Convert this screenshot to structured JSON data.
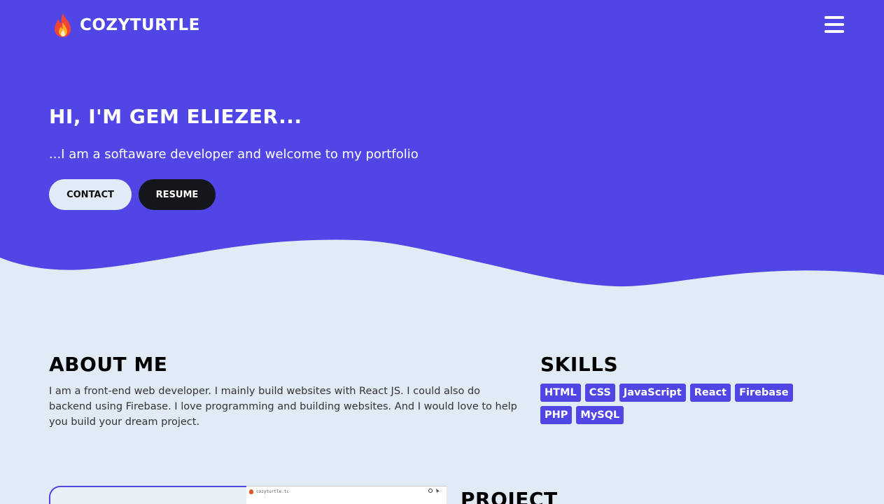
{
  "colors": {
    "primary": "#4f46e5",
    "background": "#e0ebf5",
    "dark_button": "#15161c",
    "text_dark": "#000000"
  },
  "navbar": {
    "brand_icon": "fire-icon",
    "brand_name": "COZYTURTLE",
    "menu_icon": "hamburger-menu-icon"
  },
  "hero": {
    "title": "HI, I'M GEM ELIEZER...",
    "subtitle": "...I am a softaware developer and welcome to my portfolio",
    "contact_label": "CONTACT",
    "resume_label": "RESUME"
  },
  "about": {
    "title": "ABOUT ME",
    "text": "I am a front-end web developer. I mainly build websites with React JS. I could also do backend using Firebase. I love programming and building websites. And I would love to help you build your dream project."
  },
  "skills": {
    "title": "SKILLS",
    "items": [
      "HTML",
      "CSS",
      "JavaScript",
      "React",
      "Firebase",
      "PHP",
      "MySQL"
    ]
  },
  "projects": {
    "title": "PROJECT",
    "thumb_url": "cozyturtle.tc"
  }
}
